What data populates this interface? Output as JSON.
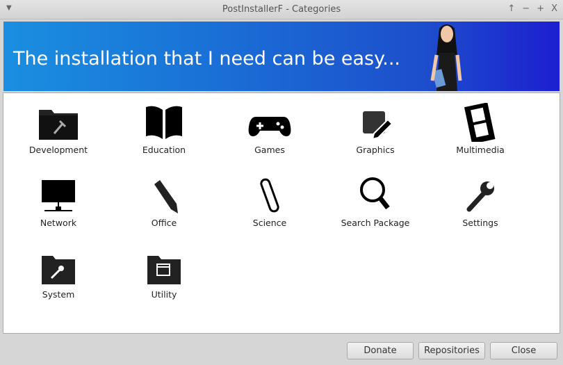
{
  "window": {
    "title": "PostInstallerF - Categories",
    "controls": [
      "↑",
      "−",
      "+",
      "X"
    ]
  },
  "banner": {
    "text": "The installation that I need can be easy..."
  },
  "categories": [
    {
      "label": "Development",
      "icon": "folder-hammer-icon"
    },
    {
      "label": "Education",
      "icon": "book-icon"
    },
    {
      "label": "Games",
      "icon": "gamepad-icon"
    },
    {
      "label": "Graphics",
      "icon": "pencil-square-icon"
    },
    {
      "label": "Multimedia",
      "icon": "film-strip-icon"
    },
    {
      "label": "Network",
      "icon": "network-monitor-icon"
    },
    {
      "label": "Office",
      "icon": "pencil-icon"
    },
    {
      "label": "Science",
      "icon": "test-tube-icon"
    },
    {
      "label": "Search Package",
      "icon": "magnifier-icon"
    },
    {
      "label": "Settings",
      "icon": "wrench-icon"
    },
    {
      "label": "System",
      "icon": "folder-wrench-icon"
    },
    {
      "label": "Utility",
      "icon": "folder-window-icon"
    }
  ],
  "buttons": {
    "donate": "Donate",
    "repositories": "Repositories",
    "close": "Close"
  }
}
